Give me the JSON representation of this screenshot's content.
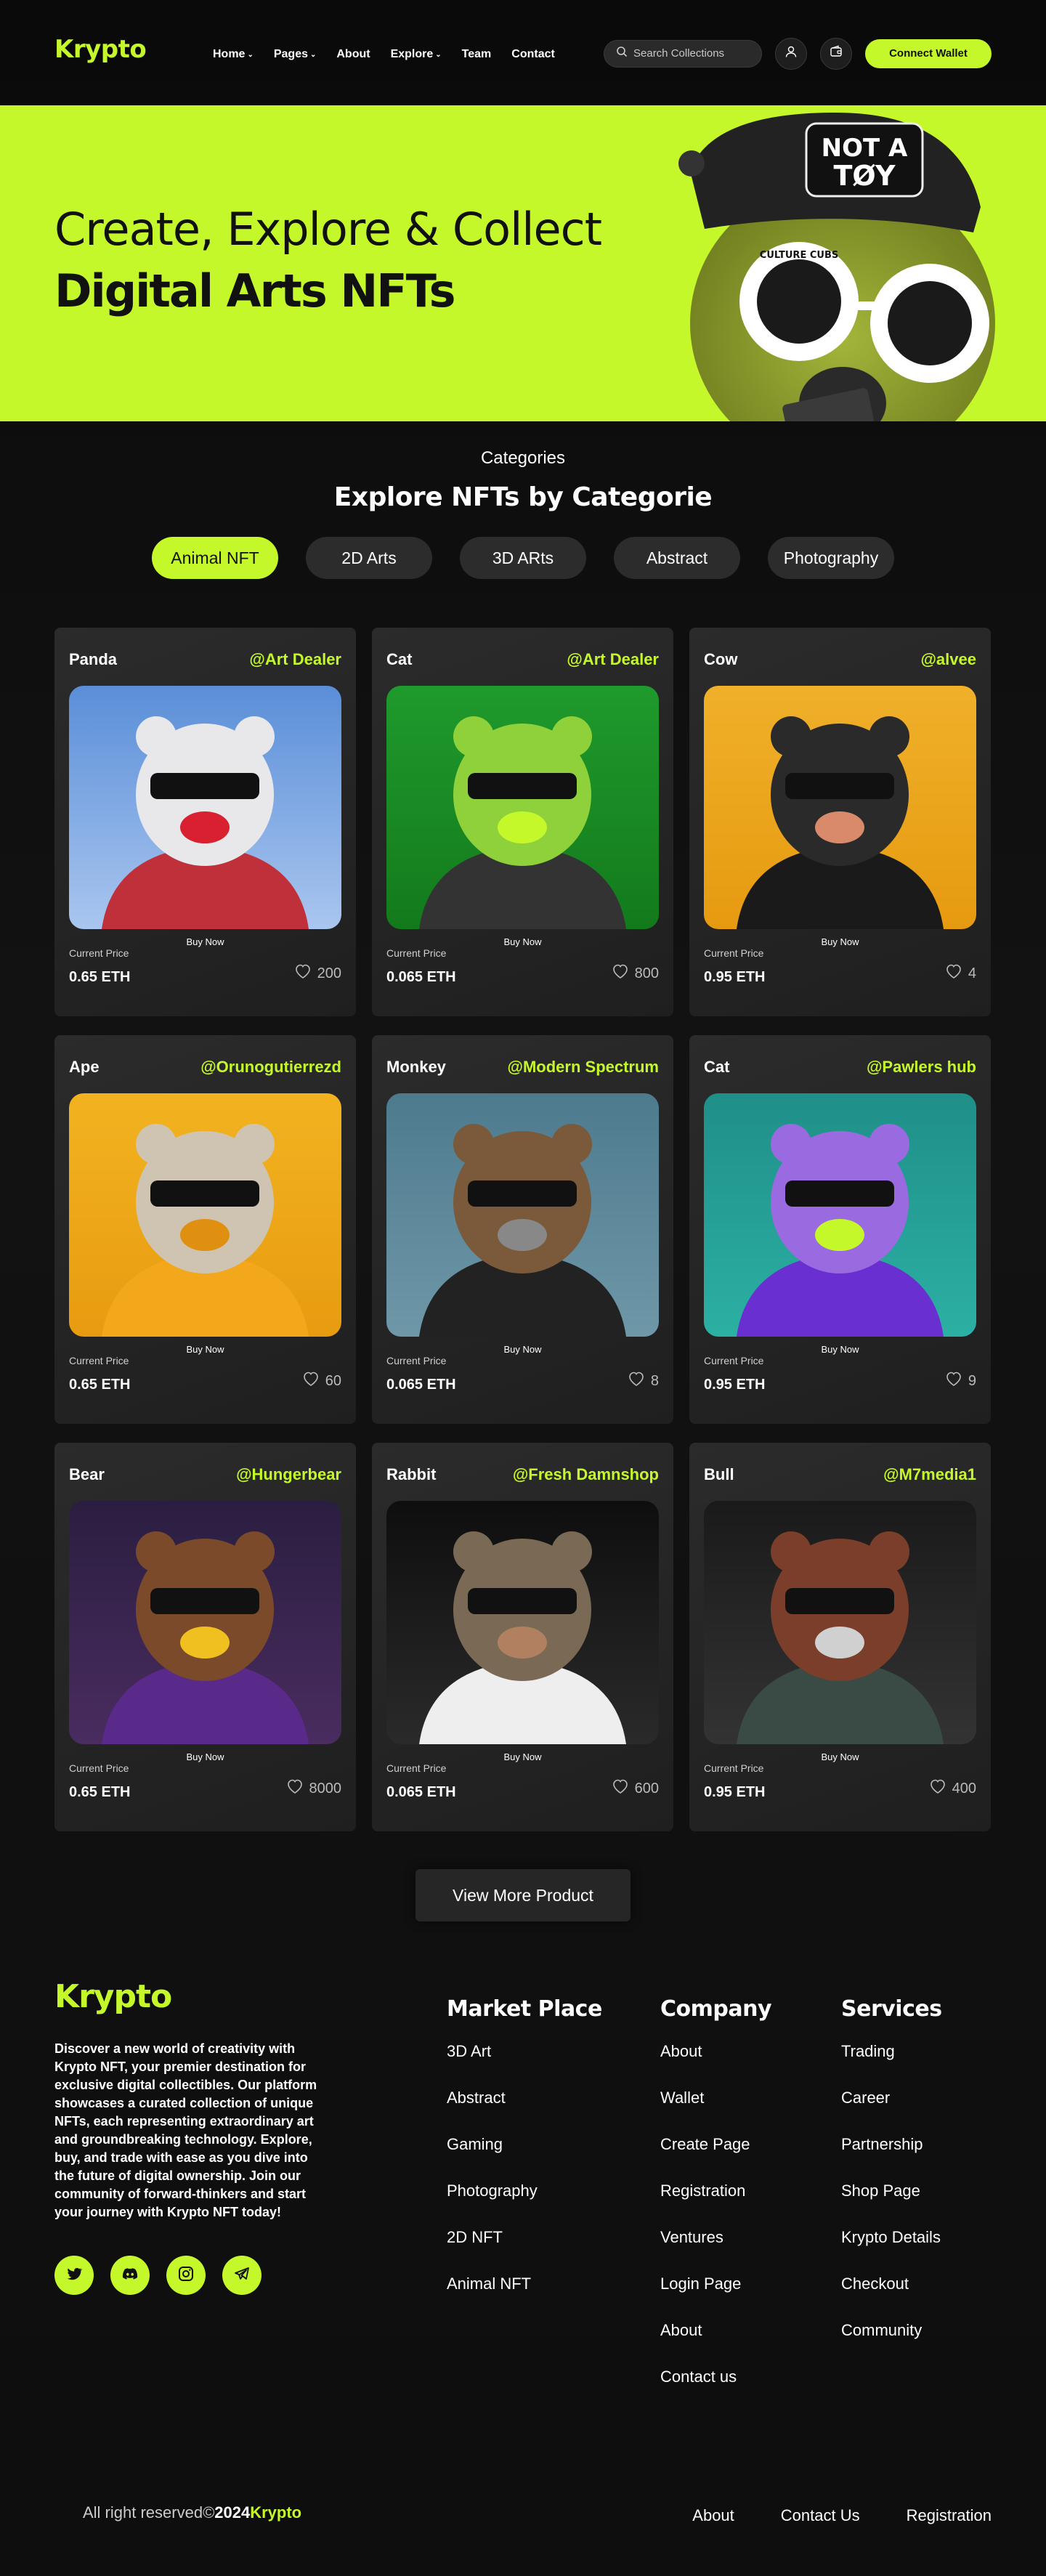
{
  "colors": {
    "accent": "#c5f82a",
    "background": "#0d0d0d",
    "card": "#262626"
  },
  "header": {
    "logo": "Krypto",
    "nav": [
      {
        "label": "Home",
        "dropdown": true
      },
      {
        "label": "Pages",
        "dropdown": true
      },
      {
        "label": "About",
        "dropdown": false
      },
      {
        "label": "Explore",
        "dropdown": true
      },
      {
        "label": "Team",
        "dropdown": false
      },
      {
        "label": "Contact",
        "dropdown": false
      }
    ],
    "search_placeholder": "Search Collections",
    "connect_label": "Connect Wallet",
    "icons": [
      "user-icon",
      "wallet-icon"
    ]
  },
  "hero": {
    "line1": "Create, Explore & Collect",
    "line2": "Digital Arts NFTs",
    "cap_text_1": "NOT A",
    "cap_text_2": "TØY",
    "glasses_text": "CULTURE CUBS"
  },
  "categories": {
    "eyebrow": "Categories",
    "title": "Explore NFTs by Categorie",
    "pills": [
      "Animal NFT",
      "2D Arts",
      "3D ARts",
      "Abstract",
      "Photography"
    ],
    "active": 0
  },
  "cards": [
    {
      "name": "Panda",
      "owner": "@Art Dealer",
      "buy": "Buy Now",
      "price_label": "Current Price",
      "price": "0.65 ETH",
      "likes": "200"
    },
    {
      "name": "Cat",
      "owner": "@Art Dealer",
      "buy": "Buy Now",
      "price_label": "Current Price",
      "price": "0.065 ETH",
      "likes": "800"
    },
    {
      "name": "Cow",
      "owner": "@alvee",
      "buy": "Buy Now",
      "price_label": "Current Price",
      "price": "0.95 ETH",
      "likes": "4"
    },
    {
      "name": "Ape",
      "owner": "@Orunogutierrezd",
      "buy": "Buy Now",
      "price_label": "Current Price",
      "price": "0.65 ETH",
      "likes": "60"
    },
    {
      "name": "Monkey",
      "owner": "@Modern Spectrum",
      "buy": "Buy Now",
      "price_label": "Current Price",
      "price": "0.065 ETH",
      "likes": "8"
    },
    {
      "name": "Cat",
      "owner": "@Pawlers hub",
      "buy": "Buy Now",
      "price_label": "Current Price",
      "price": "0.95 ETH",
      "likes": "9"
    },
    {
      "name": "Bear",
      "owner": "@Hungerbear",
      "buy": "Buy Now",
      "price_label": "Current Price",
      "price": "0.65 ETH",
      "likes": "8000"
    },
    {
      "name": "Rabbit",
      "owner": "@Fresh Damnshop",
      "buy": "Buy Now",
      "price_label": "Current Price",
      "price": "0.065 ETH",
      "likes": "600"
    },
    {
      "name": "Bull",
      "owner": "@M7media1",
      "buy": "Buy Now",
      "price_label": "Current Price",
      "price": "0.95 ETH",
      "likes": "400"
    }
  ],
  "view_more": "View More Product",
  "footer": {
    "logo": "Krypto",
    "description": "Discover a new world of creativity with Krypto NFT, your premier destination for exclusive digital collectibles. Our platform showcases a curated collection of unique NFTs, each representing extraordinary art and groundbreaking technology. Explore, buy, and trade with ease as you dive into the future of digital ownership. Join our community of forward-thinkers and start your journey with Krypto NFT today!",
    "socials": [
      "twitter-icon",
      "discord-icon",
      "instagram-icon",
      "telegram-icon"
    ],
    "columns": [
      {
        "title": "Market Place",
        "links": [
          "3D Art",
          "Abstract",
          "Gaming",
          "Photography",
          "2D NFT",
          "Animal NFT"
        ]
      },
      {
        "title": "Company",
        "links": [
          "About",
          "Wallet",
          "Create Page",
          "Registration",
          "Ventures",
          "Login Page",
          "About",
          "Contact us"
        ]
      },
      {
        "title": "Services",
        "links": [
          "Trading",
          "Career",
          "Partnership",
          "Shop Page",
          "Krypto Details",
          "Checkout",
          "Community"
        ]
      }
    ],
    "copyright_prefix": "All right reserved©",
    "copyright_year": "2024",
    "copyright_brand": "Krypto",
    "bottom_links": [
      "About",
      "Contact  Us",
      "Registration"
    ]
  }
}
